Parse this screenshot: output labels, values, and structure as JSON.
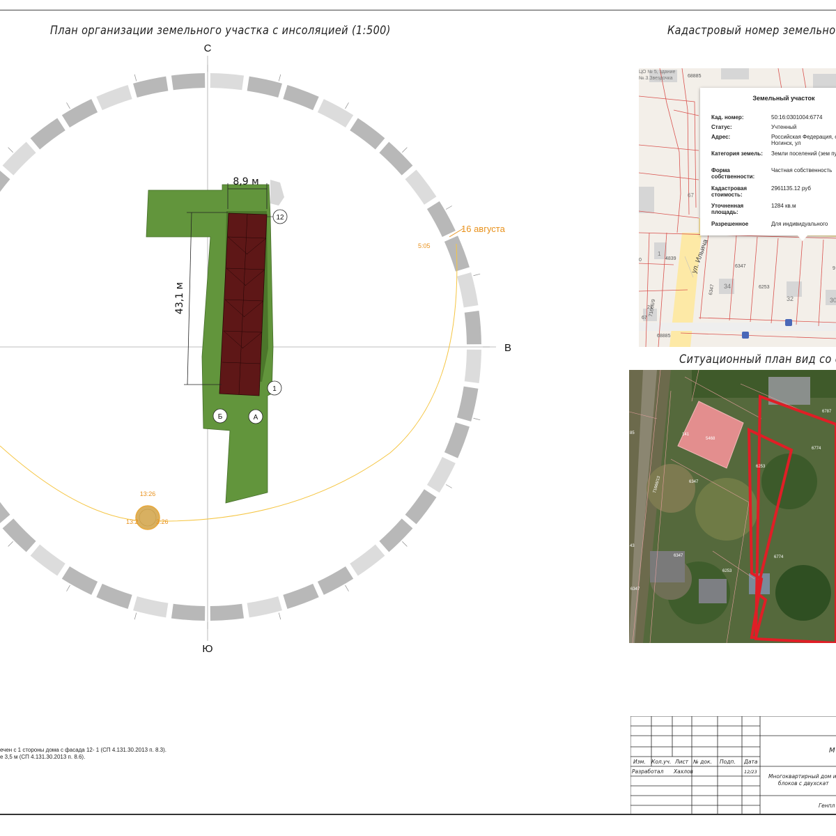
{
  "titles": {
    "main": "План организации земельного участка с инсоляцией (1:500)",
    "cadastral": "Кадастровый номер земельного",
    "situational": "Ситуационный план вид со с"
  },
  "compass": {
    "north": "С",
    "south": "Ю",
    "east": "В"
  },
  "dimensions": {
    "width": "8,9 м",
    "length": "43,1 м"
  },
  "markers": {
    "m12": "12",
    "m1": "1",
    "b": "Б",
    "a": "А"
  },
  "sun": {
    "date": "16 августа",
    "sunrise": "5:05",
    "noon": "13:26",
    "noon_label_left": "13:2",
    "noon_label_right": "3:26"
  },
  "cadastral_popup": {
    "title": "Земельный участок",
    "rows": [
      {
        "key": "Кад. номер:",
        "value": "50:16:0301004:6774"
      },
      {
        "key": "Статус:",
        "value": "Учтенный"
      },
      {
        "key": "Адрес:",
        "value": "Российская Федерация, область, г. Ногинск, ул"
      },
      {
        "key": "Категория земель:",
        "value": "Земли поселений (зем пунктов)"
      },
      {
        "key": "Форма собственности:",
        "value": "Частная собственность"
      },
      {
        "key": "Кадастровая стоимость:",
        "value": "2961135.12 руб"
      },
      {
        "key": "Уточненная площадь:",
        "value": "1284 кв.м"
      },
      {
        "key": "Разрешенное",
        "value": "Для индивидуального"
      }
    ]
  },
  "map_labels": {
    "top_left": "ЦО № 5, здание",
    "top_left2": "№ 3 Звездочка",
    "n68885_top": "68885",
    "n67": "67",
    "n1": "1",
    "n4839": "4839",
    "n6347a": "6347",
    "street": "ул. Ильича",
    "n34": "34",
    "n6253": "6253",
    "n32": "32",
    "n6347b": "6347",
    "n68885_bottom": "68885",
    "n71666": "71666/9",
    "n67b": "67",
    "n30": "30",
    "n9": "9",
    "n0": "0",
    "n21": "21"
  },
  "sat_labels": {
    "n5468": "5468",
    "n141": "141",
    "n6787": "6787",
    "n6774a": "6774",
    "n6253a": "6253",
    "n6347a": "6347",
    "n71666": "71666/13",
    "n6774b": "6774",
    "n6347b": "6347",
    "n6253b": "6253",
    "n6347c": "6347",
    "n85": "85",
    "n43": "43"
  },
  "notes": {
    "line1": "ечен с 1 стороны дома с фасада 12- 1 (СП 4.131.30.2013 п. 8.3).",
    "line2": "е 3,5 м (СП 4.131.30.2013 п. 8.6)."
  },
  "stamp": {
    "izm": "Изм.",
    "kol": "Кол.уч.",
    "list": "Лист",
    "ndok": "№ док.",
    "podp": "Подп.",
    "data": "Дата",
    "razrab": "Разработал",
    "author": "Хахлов",
    "date_val": "12/23",
    "m_letter": "М",
    "project1": "Многоквартирный дом и",
    "project2": "блоков с двухскат",
    "genplan": "Генпл"
  },
  "colors": {
    "lot": "#62953c",
    "building": "#5e1717",
    "sun_path": "#f5c542",
    "orange_text": "#e8911c",
    "ring_dark": "#b8b8b8",
    "ring_light": "#dcdcdc",
    "red_boundary": "#e01e26"
  }
}
